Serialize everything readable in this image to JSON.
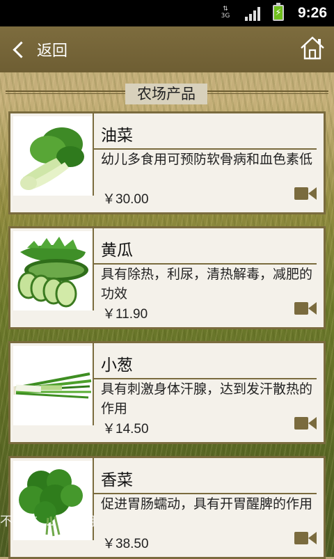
{
  "status_bar": {
    "network": "3G",
    "time": "9:26"
  },
  "title_bar": {
    "back_label": "返回"
  },
  "section": {
    "title": "农场产品"
  },
  "products": [
    {
      "name": "油菜",
      "desc": "幼儿多食用可预防软骨病和血色素低",
      "price": "￥30.00"
    },
    {
      "name": "黄瓜",
      "desc": "具有除热，利尿，清热解毒，减肥的功效",
      "price": "￥11.90"
    },
    {
      "name": "小葱",
      "desc": "具有刺激身体汗腺，达到发汗散热的作用",
      "price": "￥14.50"
    },
    {
      "name": "香菜",
      "desc": "促进胃肠蠕动，具有开胃醒脾的作用",
      "price": "￥38.50"
    }
  ],
  "icons": {
    "back": "chevron-left-icon",
    "home": "home-icon",
    "video": "video-camera-icon"
  },
  "colors": {
    "accent": "#7a6b3e",
    "title_bar": "#6e5e33",
    "card_bg": "#f4f1ea"
  },
  "overlay": {
    "watermark_text": "不要吃 … 购可用"
  }
}
